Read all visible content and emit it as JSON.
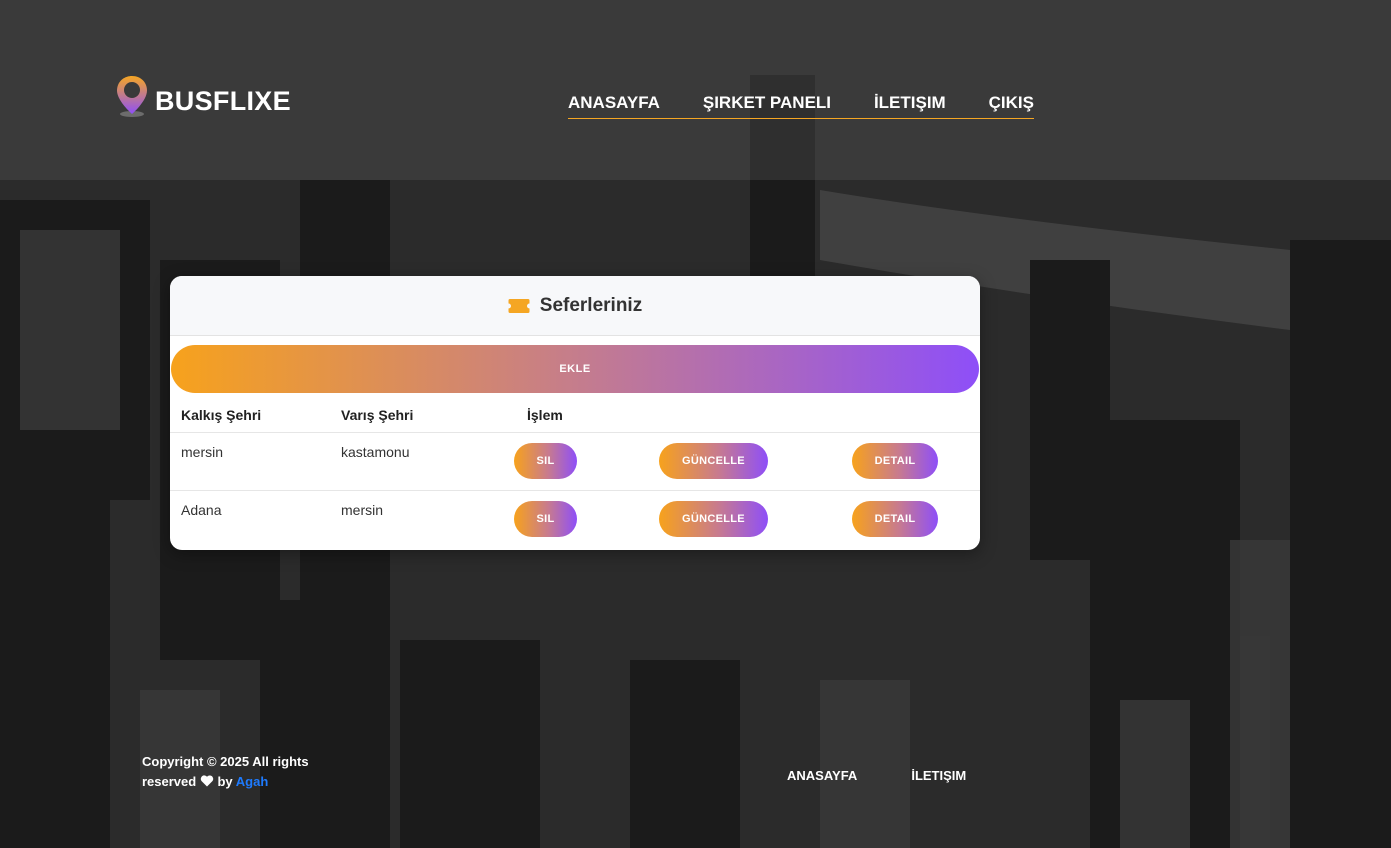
{
  "brand": {
    "name": "BUSFLIXE",
    "accent": "#f5a623",
    "accent2": "#8e4ff8"
  },
  "nav": [
    {
      "label": "ANASAYFA"
    },
    {
      "label": "ŞIRKET PANELI"
    },
    {
      "label": "İLETIŞIM"
    },
    {
      "label": "ÇIKIŞ"
    }
  ],
  "card": {
    "title": "Seferleriniz",
    "icon": "ticket-icon",
    "add_label": "EKLE",
    "columns": [
      "Kalkış Şehri",
      "Varış Şehri",
      "İşlem"
    ],
    "rows": [
      {
        "from": "mersin",
        "to": "kastamonu"
      },
      {
        "from": "Adana",
        "to": "mersin"
      }
    ],
    "actions": {
      "delete": "SIL",
      "update": "GÜNCELLE",
      "detail": "DETAIL"
    }
  },
  "footer": {
    "copyright_prefix": "Copyright © 2025 All rights reserved",
    "by": "by",
    "author": "Agah",
    "links": [
      {
        "label": "ANASAYFA"
      },
      {
        "label": "İLETIŞIM"
      }
    ]
  }
}
